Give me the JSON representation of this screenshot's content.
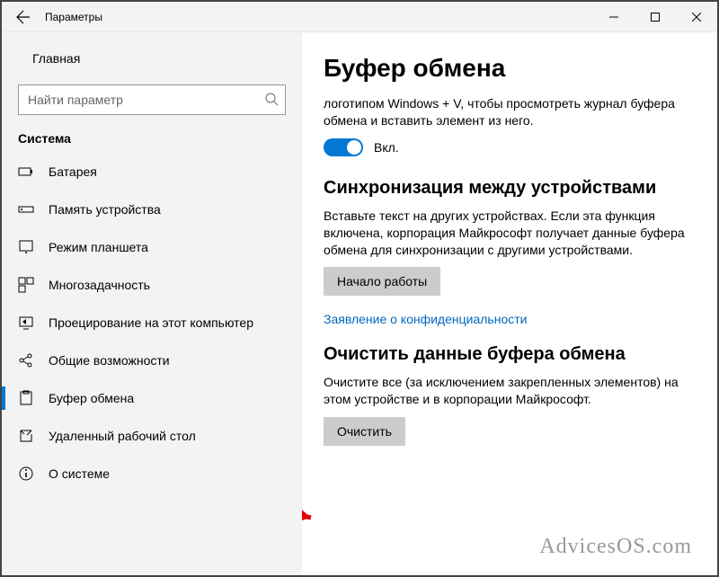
{
  "window": {
    "title": "Параметры"
  },
  "sidebar": {
    "home": "Главная",
    "search_placeholder": "Найти параметр",
    "category": "Система",
    "items": [
      {
        "label": "Батарея"
      },
      {
        "label": "Память устройства"
      },
      {
        "label": "Режим планшета"
      },
      {
        "label": "Многозадачность"
      },
      {
        "label": "Проецирование на этот компьютер"
      },
      {
        "label": "Общие возможности"
      },
      {
        "label": "Буфер обмена"
      },
      {
        "label": "Удаленный рабочий стол"
      },
      {
        "label": "О системе"
      }
    ]
  },
  "main": {
    "heading": "Буфер обмена",
    "history_desc": "логотипом Windows + V, чтобы просмотреть журнал буфера обмена и вставить элемент из него.",
    "toggle_label": "Вкл.",
    "sync_heading": "Синхронизация между устройствами",
    "sync_desc": "Вставьте текст на других устройствах. Если эта функция включена, корпорация Майкрософт получает данные буфера обмена для синхронизации с другими устройствами.",
    "sync_button": "Начало работы",
    "privacy_link": "Заявление о конфиденциальности",
    "clear_heading": "Очистить данные буфера обмена",
    "clear_desc": "Очистите все (за исключением закрепленных элементов) на этом устройстве и в корпорации Майкрософт.",
    "clear_button": "Очистить"
  },
  "watermark": "AdvicesOS.com"
}
